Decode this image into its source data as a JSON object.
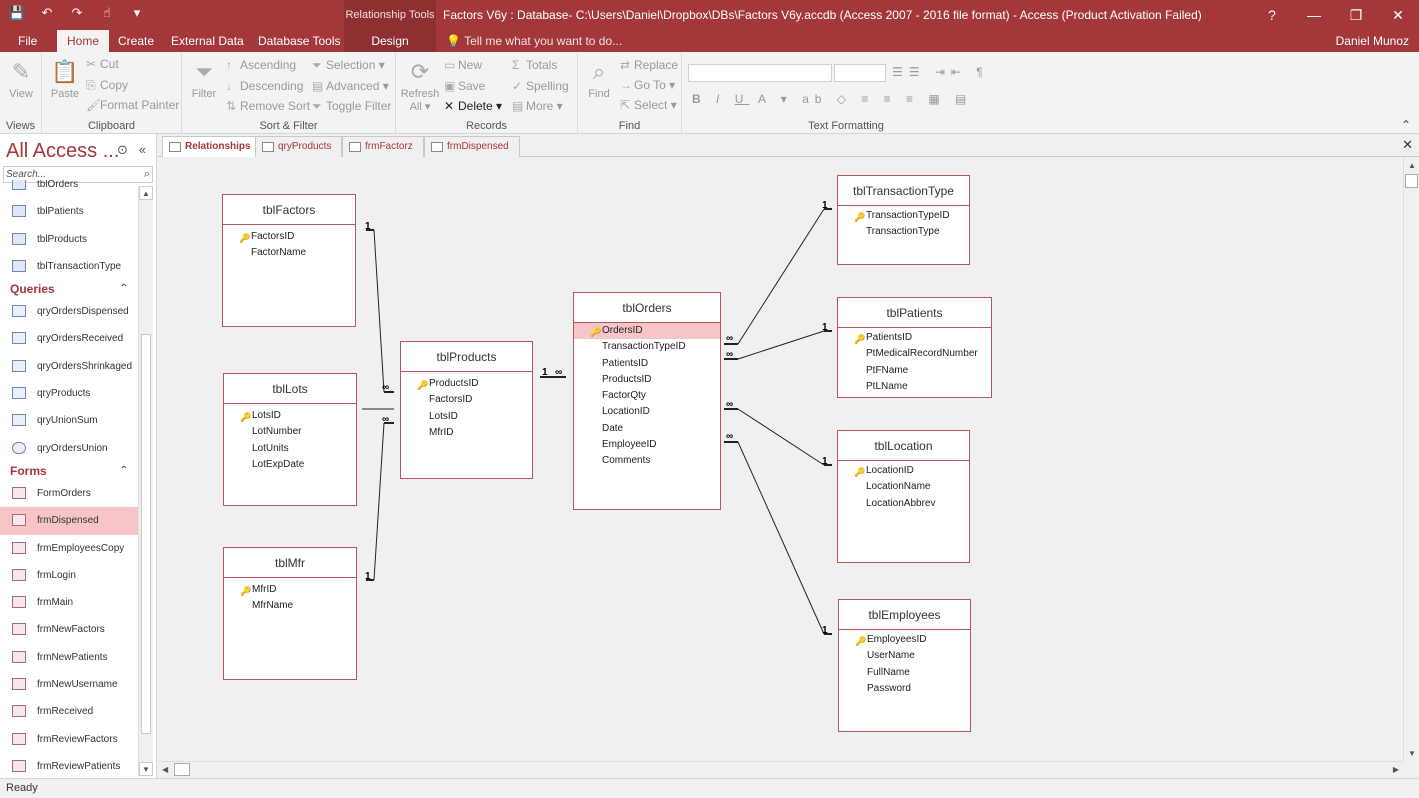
{
  "window": {
    "title": "Factors V6y : Database- C:\\Users\\Daniel\\Dropbox\\DBs\\Factors V6y.accdb (Access 2007 - 2016 file format) - Access (Product Activation Failed)",
    "context_tools": "Relationship Tools",
    "user": "Daniel Munoz"
  },
  "ribbon_tabs": [
    {
      "label": "File"
    },
    {
      "label": "Home"
    },
    {
      "label": "Create"
    },
    {
      "label": "External Data"
    },
    {
      "label": "Database Tools"
    },
    {
      "label": "Design"
    }
  ],
  "tell_me": "Tell me what you want to do...",
  "ribbon": {
    "views": {
      "label": "Views",
      "view": "View"
    },
    "clipboard": {
      "label": "Clipboard",
      "paste": "Paste",
      "cut": "Cut",
      "copy": "Copy",
      "format_painter": "Format Painter"
    },
    "sort_filter": {
      "label": "Sort & Filter",
      "filter": "Filter",
      "ascending": "Ascending",
      "descending": "Descending",
      "remove_sort": "Remove Sort",
      "selection": "Selection",
      "advanced": "Advanced",
      "toggle_filter": "Toggle Filter"
    },
    "records": {
      "label": "Records",
      "refresh": "Refresh",
      "refresh2": "All",
      "new": "New",
      "save": "Save",
      "delete": "Delete",
      "totals": "Totals",
      "spelling": "Spelling",
      "more": "More"
    },
    "find": {
      "label": "Find",
      "find": "Find",
      "replace": "Replace",
      "goto": "Go To",
      "select": "Select"
    },
    "text_formatting": {
      "label": "Text Formatting"
    }
  },
  "nav": {
    "header": "All Access ...",
    "search_placeholder": "Search...",
    "items_top": [
      {
        "label": "tblOrders",
        "type": "table"
      },
      {
        "label": "tblPatients",
        "type": "table"
      },
      {
        "label": "tblProducts",
        "type": "table"
      },
      {
        "label": "tblTransactionType",
        "type": "table"
      }
    ],
    "queries_label": "Queries",
    "queries": [
      {
        "label": "qryOrdersDispensed"
      },
      {
        "label": "qryOrdersReceived"
      },
      {
        "label": "qryOrdersShrinkaged"
      },
      {
        "label": "qryProducts"
      },
      {
        "label": "qryUnionSum"
      },
      {
        "label": "qryOrdersUnion"
      }
    ],
    "forms_label": "Forms",
    "forms": [
      {
        "label": "FormOrders"
      },
      {
        "label": "frmDispensed"
      },
      {
        "label": "frmEmployeesCopy"
      },
      {
        "label": "frmLogin"
      },
      {
        "label": "frmMain"
      },
      {
        "label": "frmNewFactors"
      },
      {
        "label": "frmNewPatients"
      },
      {
        "label": "frmNewUsername"
      },
      {
        "label": "frmReceived"
      },
      {
        "label": "frmReviewFactors"
      },
      {
        "label": "frmReviewPatients"
      }
    ]
  },
  "doc_tabs": [
    {
      "label": "Relationships"
    },
    {
      "label": "qryProducts"
    },
    {
      "label": "frmFactorz"
    },
    {
      "label": "frmDispensed"
    }
  ],
  "tables": {
    "tblFactors": {
      "title": "tblFactors",
      "fields": [
        "FactorsID",
        "FactorName"
      ]
    },
    "tblLots": {
      "title": "tblLots",
      "fields": [
        "LotsID",
        "LotNumber",
        "LotUnits",
        "LotExpDate"
      ]
    },
    "tblMfr": {
      "title": "tblMfr",
      "fields": [
        "MfrID",
        "MfrName"
      ]
    },
    "tblProducts": {
      "title": "tblProducts",
      "fields": [
        "ProductsID",
        "FactorsID",
        "LotsID",
        "MfrID"
      ]
    },
    "tblOrders": {
      "title": "tblOrders",
      "fields": [
        "OrdersID",
        "TransactionTypeID",
        "PatientsID",
        "ProductsID",
        "FactorQty",
        "LocationID",
        "Date",
        "EmployeeID",
        "Comments"
      ]
    },
    "tblTransactionType": {
      "title": "tblTransactionType",
      "fields": [
        "TransactionTypeID",
        "TransactionType"
      ]
    },
    "tblPatients": {
      "title": "tblPatients",
      "fields": [
        "PatientsID",
        "PtMedicalRecordNumber",
        "PtFName",
        "PtLName"
      ]
    },
    "tblLocation": {
      "title": "tblLocation",
      "fields": [
        "LocationID",
        "LocationName",
        "LocationAbbrev"
      ]
    },
    "tblEmployees": {
      "title": "tblEmployees",
      "fields": [
        "EmployeesID",
        "UserName",
        "FullName",
        "Password"
      ]
    }
  },
  "cardinality": {
    "one": "1",
    "many": "∞"
  },
  "status": "Ready"
}
